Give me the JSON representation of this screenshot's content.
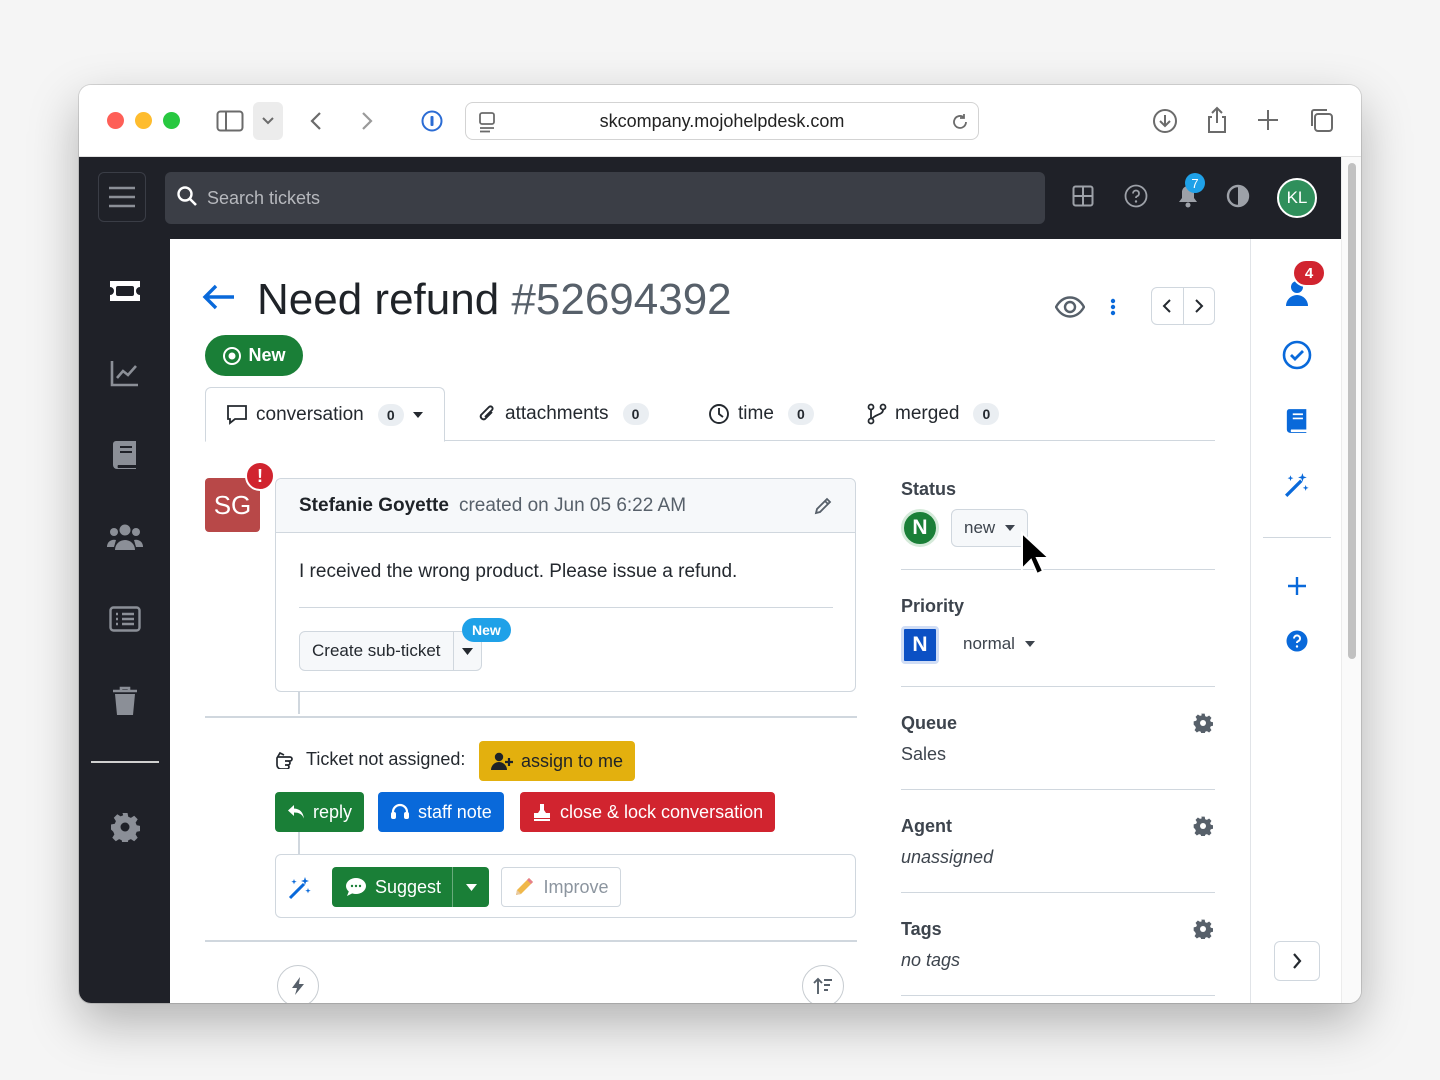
{
  "browser": {
    "url": "skcompany.mojohelpdesk.com"
  },
  "topbar": {
    "search_placeholder": "Search tickets",
    "notification_count": "7",
    "user_initials": "KL"
  },
  "ticket": {
    "title": "Need refund",
    "number": "#52694392",
    "status_badge": "New"
  },
  "tabs": [
    {
      "label": "conversation",
      "count": "0"
    },
    {
      "label": "attachments",
      "count": "0"
    },
    {
      "label": "time",
      "count": "0"
    },
    {
      "label": "merged",
      "count": "0"
    }
  ],
  "message": {
    "avatar_initials": "SG",
    "alert": "!",
    "author": "Stefanie Goyette",
    "meta": "created on Jun 05 6:22 AM",
    "body": "I received the wrong product. Please issue a refund.",
    "subticket_label": "Create sub-ticket",
    "new_pill": "New"
  },
  "actions": {
    "not_assigned_label": "Ticket not assigned:",
    "assign_label": "assign to me",
    "reply_label": "reply",
    "staff_note_label": "staff note",
    "close_lock_label": "close & lock conversation",
    "suggest_label": "Suggest",
    "improve_label": "Improve"
  },
  "properties": {
    "status": {
      "label": "Status",
      "badge": "N",
      "value": "new"
    },
    "priority": {
      "label": "Priority",
      "badge": "N",
      "value": "normal"
    },
    "queue": {
      "label": "Queue",
      "value": "Sales"
    },
    "agent": {
      "label": "Agent",
      "value": "unassigned"
    },
    "tags": {
      "label": "Tags",
      "value": "no tags"
    }
  },
  "right_rail": {
    "watchers_count": "4"
  },
  "colors": {
    "app_dark": "#1f2128",
    "primary_blue": "#0969da",
    "success_green": "#1a7f37",
    "danger_red": "#d1242f",
    "warning_yellow": "#e3b00e",
    "avatar_red": "#b84848"
  }
}
